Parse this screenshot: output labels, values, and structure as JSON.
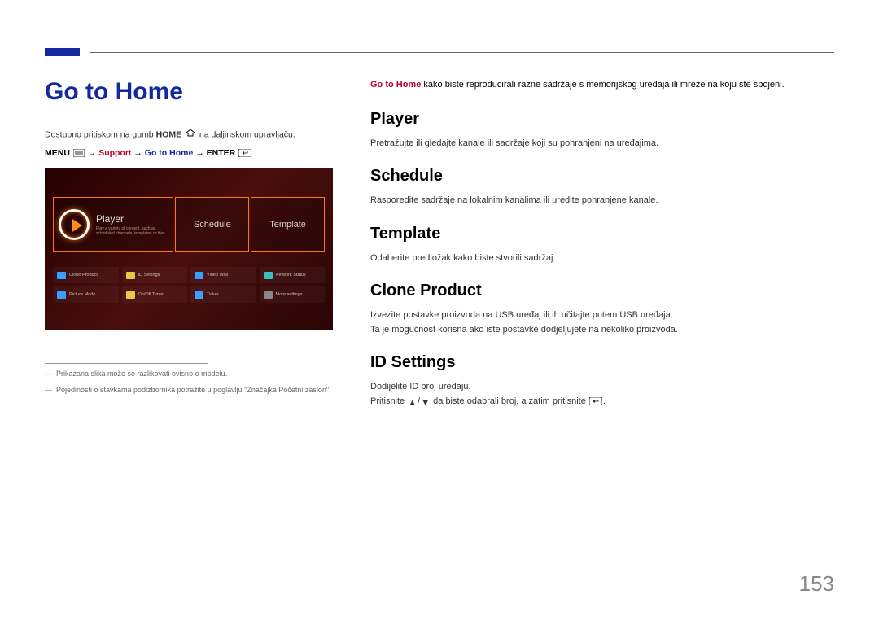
{
  "page_title": "Go to Home",
  "left": {
    "desc_pre": "Dostupno pritiskom na gumb ",
    "desc_bold": "HOME",
    "desc_post": " na daljinskom upravljaču.",
    "path": {
      "menu": "MENU",
      "arrow": "→",
      "support": "Support",
      "goto": "Go to Home",
      "enter": "ENTER"
    },
    "screenshot": {
      "player": {
        "title": "Player",
        "sub": "Play a variety of content, such as scheduled channels, templates or files."
      },
      "schedule": "Schedule",
      "template": "Template",
      "items": [
        "Clone Product",
        "ID Settings",
        "Video Wall",
        "Network Status",
        "Picture Mode",
        "On/Off Timer",
        "Ticker",
        "More settings"
      ]
    },
    "notes": [
      "Prikazana slika može se razlikovati ovisno o modelu.",
      "Pojedinosti o stavkama podizbornika potražite u poglavlju \"Značajka Početni zaslon\"."
    ]
  },
  "right": {
    "intro_bold": "Go to Home",
    "intro_rest": " kako biste reproducirali razne sadržaje s memorijskog uređaja ili mreže na koju ste spojeni.",
    "sections": {
      "player": {
        "h": "Player",
        "p": "Pretražujte ili gledajte kanale ili sadržaje koji su pohranjeni na uređajima."
      },
      "schedule": {
        "h": "Schedule",
        "p": "Rasporedite sadržaje na lokalnim kanalima ili uredite pohranjene kanale."
      },
      "template": {
        "h": "Template",
        "p": "Odaberite predložak kako biste stvorili sadržaj."
      },
      "clone": {
        "h": "Clone Product",
        "p1": "Izvezite postavke proizvoda na USB uređaj ili ih učitajte putem USB uređaja.",
        "p2": "Ta je mogućnost korisna ako iste postavke dodjeljujete na nekoliko proizvoda."
      },
      "id": {
        "h": "ID Settings",
        "p1": "Dodijelite ID broj uređaju.",
        "p2_pre": "Pritisnite ",
        "p2_mid": " da biste odabrali broj, a zatim pritisnite ",
        "p2_post": "."
      }
    }
  },
  "page_number": "153"
}
